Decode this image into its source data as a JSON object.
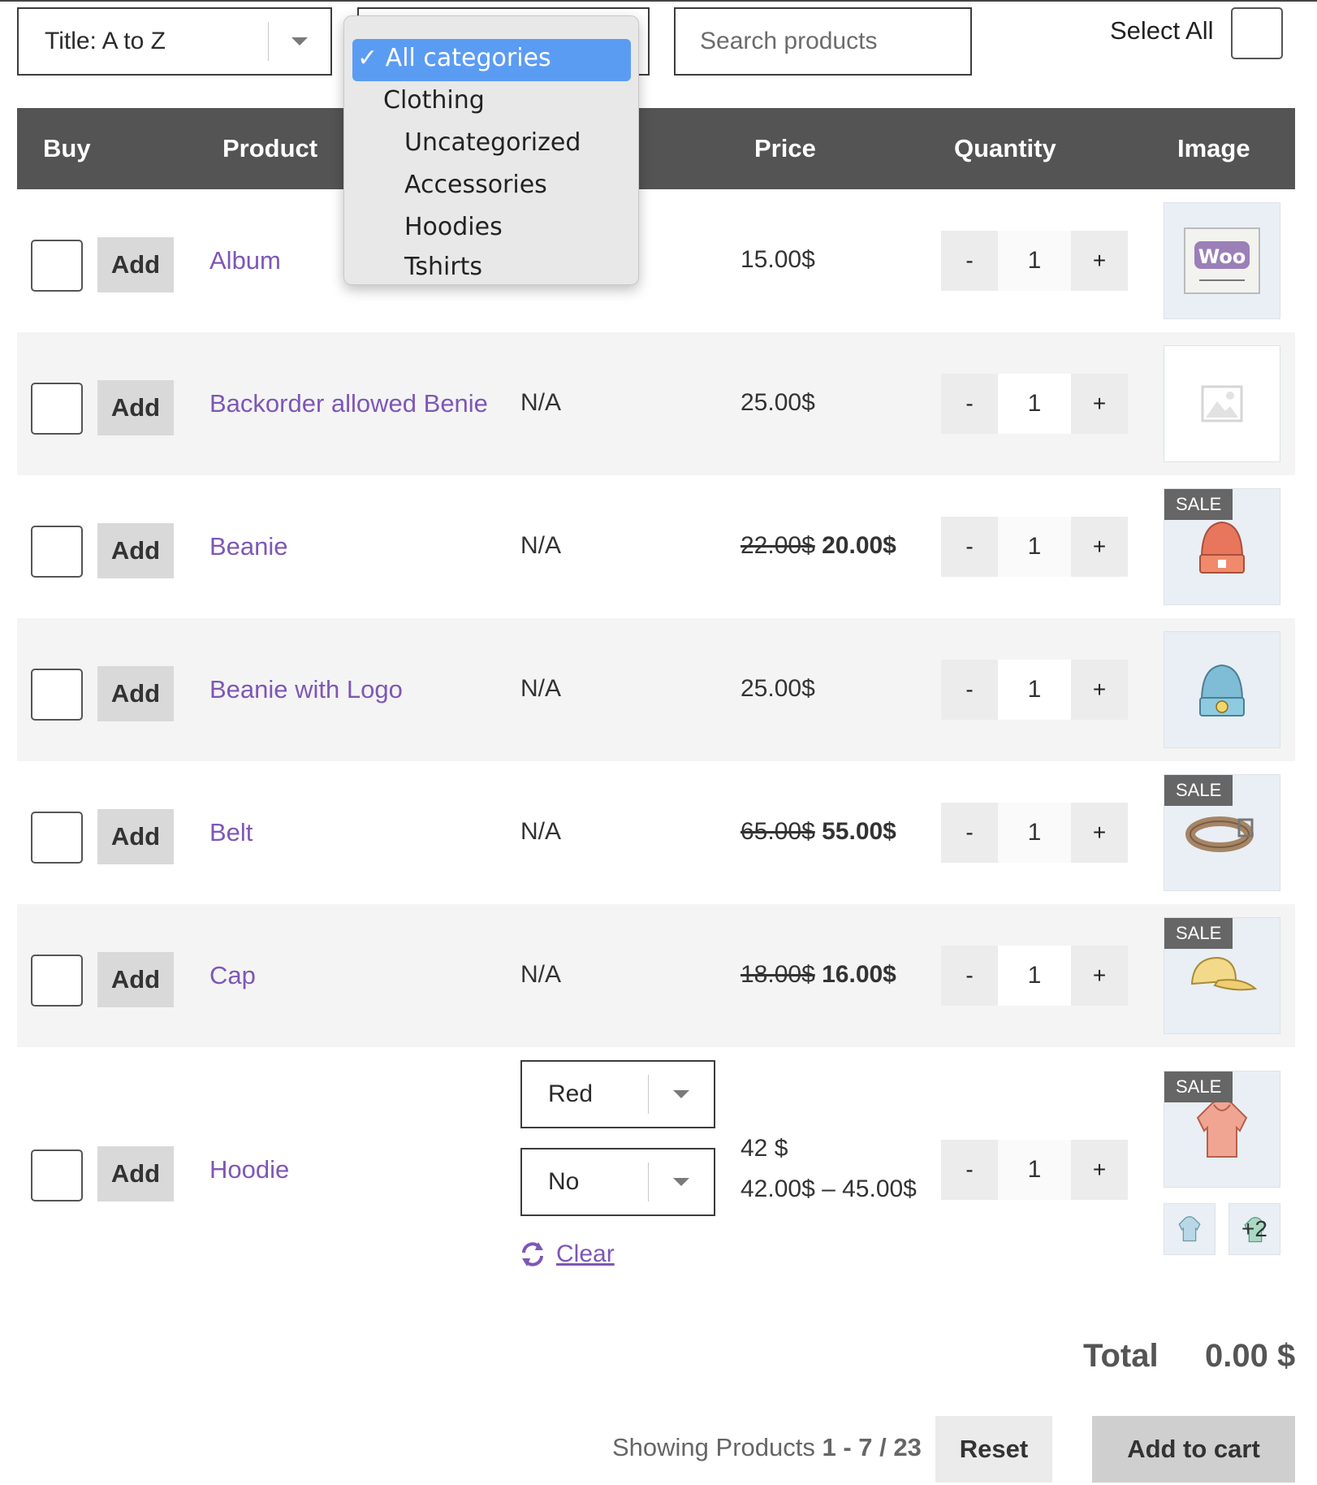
{
  "toolbar": {
    "sort_value": "Title: A to Z",
    "search_placeholder": "Search products",
    "select_all_label": "Select All"
  },
  "category_dropdown": {
    "options": [
      {
        "label": "✓ All categories",
        "selected": true
      },
      {
        "label": "Clothing",
        "selected": false
      },
      {
        "label": "Uncategorized",
        "selected": false
      },
      {
        "label": "Accessories",
        "selected": false
      },
      {
        "label": "Hoodies",
        "selected": false
      },
      {
        "label": "Tshirts",
        "selected": false
      }
    ]
  },
  "table": {
    "headers": {
      "buy": "Buy",
      "product": "Product",
      "price": "Price",
      "quantity": "Quantity",
      "image": "Image"
    },
    "add_label": "Add",
    "rows": [
      {
        "name": "Album",
        "category": "",
        "price": "15.00$",
        "old_price": "",
        "qty": "1",
        "image": "woo-album-icon",
        "sale": ""
      },
      {
        "name": "Backorder allowed Benie",
        "category": "N/A",
        "price": "25.00$",
        "old_price": "",
        "qty": "1",
        "image": "placeholder-image-icon",
        "sale": ""
      },
      {
        "name": "Beanie",
        "category": "N/A",
        "price": "20.00$",
        "old_price": "22.00$",
        "qty": "1",
        "image": "beanie-icon",
        "sale": "SALE"
      },
      {
        "name": "Beanie with Logo",
        "category": "N/A",
        "price": "25.00$",
        "old_price": "",
        "qty": "1",
        "image": "beanie-logo-icon",
        "sale": ""
      },
      {
        "name": "Belt",
        "category": "N/A",
        "price": "55.00$",
        "old_price": "65.00$",
        "qty": "1",
        "image": "belt-icon",
        "sale": "SALE"
      },
      {
        "name": "Cap",
        "category": "N/A",
        "price": "16.00$",
        "old_price": "18.00$",
        "qty": "1",
        "image": "cap-icon",
        "sale": "SALE"
      },
      {
        "name": "Hoodie",
        "category": "",
        "price": "42 $",
        "price_range": "42.00$ – 45.00$",
        "qty": "1",
        "image": "hoodie-icon",
        "sale": "SALE",
        "variation_color": "Red",
        "variation_logo": "No",
        "clear_label": "Clear",
        "extra_thumbs_label": "+2"
      }
    ],
    "minus": "-",
    "plus": "+"
  },
  "footer": {
    "total_label": "Total",
    "total_value": "0.00 $",
    "showing_prefix": "Showing Products ",
    "showing_range": "1 - 7 / 23",
    "reset_label": "Reset",
    "add_to_cart_label": "Add to cart"
  },
  "colors": {
    "header_bg": "#545454",
    "link": "#7e57b6",
    "highlight": "#5b9cf3"
  }
}
